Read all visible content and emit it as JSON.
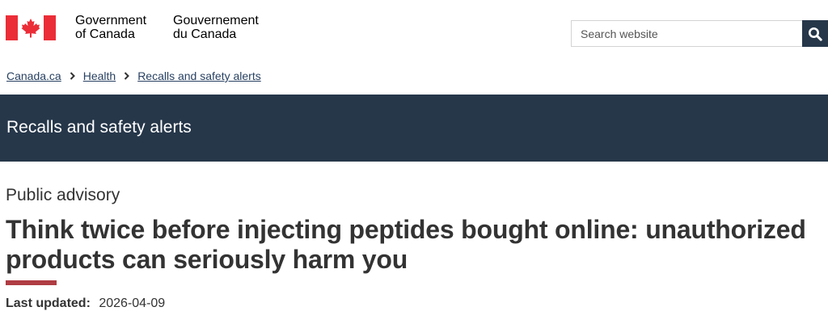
{
  "header": {
    "wordmark_en": [
      "Government",
      "of Canada"
    ],
    "wordmark_fr": [
      "Gouvernement",
      "du Canada"
    ],
    "flag_icon": "canada-flag",
    "flag_color": "#eb2d37"
  },
  "search": {
    "placeholder": "Search website",
    "button_icon": "search-icon",
    "button_color": "#26374a"
  },
  "breadcrumb": {
    "items": [
      "Canada.ca",
      "Health",
      "Recalls and safety alerts"
    ],
    "separator_icon": "chevron-right-icon"
  },
  "banner": {
    "title": "Recalls and safety alerts",
    "color": "#26374a"
  },
  "main": {
    "eyebrow": "Public advisory",
    "title": "Think twice before injecting peptides bought online: unauthorized products can seriously harm you",
    "rule_color": "#af3c43",
    "last_updated_label": "Last updated:",
    "last_updated_value": "2026-04-09"
  }
}
